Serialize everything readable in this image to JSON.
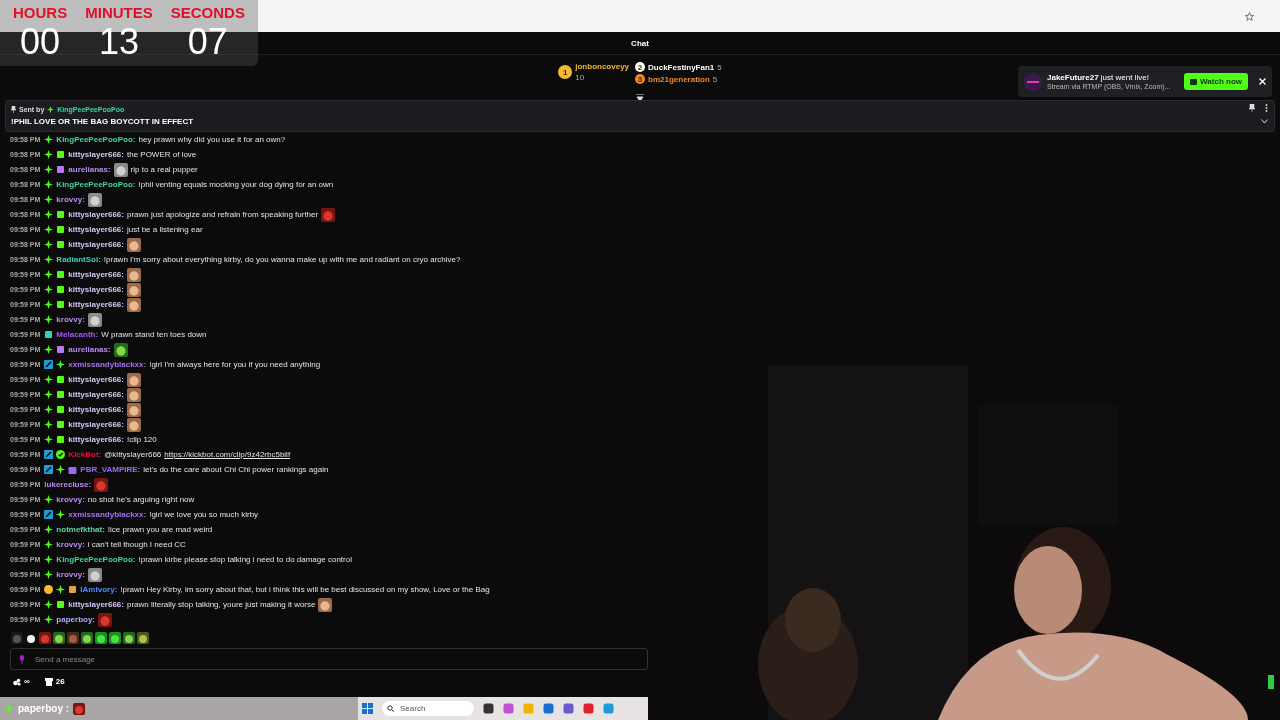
{
  "timer": {
    "units": [
      {
        "label": "HOURS",
        "value": "00"
      },
      {
        "label": "MINUTES",
        "value": "13"
      },
      {
        "label": "SECONDS",
        "value": "07"
      }
    ]
  },
  "chat": {
    "title": "Chat",
    "leaderboard": [
      {
        "rank": "1",
        "name": "jonboncoveyy",
        "count": "10",
        "color": "#f5b82e"
      },
      {
        "rank": "2",
        "name": "DuckFestinyFan1",
        "count": "5",
        "color": "#ffffff"
      },
      {
        "rank": "3",
        "name": "bm21generation",
        "count": "5",
        "color": "#f08a24"
      }
    ],
    "pinned": {
      "sent_by": "Sent by",
      "user": "KingPeePeePooPoo",
      "text": "!PHIL LOVE OR THE BAG BOYCOTT IN EFFECT"
    },
    "messages": [
      {
        "time": "09:58 PM",
        "badges": [
          {
            "kind": "star",
            "color": "#53fc18"
          }
        ],
        "user": "KingPeePeePooPoo:",
        "color": "#3fd7a0",
        "parts": [
          {
            "kind": "text",
            "text": "hey prawn why did you use it for an own?"
          }
        ]
      },
      {
        "time": "09:58 PM",
        "badges": [
          {
            "kind": "star",
            "color": "#53fc18"
          },
          {
            "kind": "box",
            "color": "#53fc18"
          }
        ],
        "user": "kittyslayer666:",
        "color": "#d9c6f5",
        "parts": [
          {
            "kind": "text",
            "text": "the POWER of love"
          }
        ]
      },
      {
        "time": "09:58 PM",
        "badges": [
          {
            "kind": "star",
            "color": "#53fc18"
          },
          {
            "kind": "box",
            "color": "#b47cf0"
          }
        ],
        "user": "aurelianas:",
        "color": "#b98cf5",
        "parts": [
          {
            "kind": "cat"
          },
          {
            "kind": "text",
            "text": "rip to a real pupper"
          }
        ]
      },
      {
        "time": "09:58 PM",
        "badges": [
          {
            "kind": "star",
            "color": "#53fc18"
          }
        ],
        "user": "KingPeePeePooPoo:",
        "color": "#3fd7a0",
        "parts": [
          {
            "kind": "text",
            "text": "!phil venting equals mocking your dog dying for an own"
          }
        ]
      },
      {
        "time": "09:58 PM",
        "badges": [
          {
            "kind": "star",
            "color": "#53fc18"
          }
        ],
        "user": "krovvy:",
        "color": "#b98cf5",
        "parts": [
          {
            "kind": "cat"
          }
        ]
      },
      {
        "time": "09:58 PM",
        "badges": [
          {
            "kind": "star",
            "color": "#53fc18"
          },
          {
            "kind": "box",
            "color": "#53fc18"
          }
        ],
        "user": "kittyslayer666:",
        "color": "#d9c6f5",
        "parts": [
          {
            "kind": "text",
            "text": "prawn just apologize and refrain from speaking further"
          },
          {
            "kind": "red"
          }
        ]
      },
      {
        "time": "09:58 PM",
        "badges": [
          {
            "kind": "star",
            "color": "#53fc18"
          },
          {
            "kind": "box",
            "color": "#53fc18"
          }
        ],
        "user": "kittyslayer666:",
        "color": "#d9c6f5",
        "parts": [
          {
            "kind": "text",
            "text": "just be a listening ear"
          }
        ]
      },
      {
        "time": "09:58 PM",
        "badges": [
          {
            "kind": "star",
            "color": "#53fc18"
          },
          {
            "kind": "box",
            "color": "#53fc18"
          }
        ],
        "user": "kittyslayer666:",
        "color": "#d9c6f5",
        "parts": [
          {
            "kind": "tan"
          }
        ]
      },
      {
        "time": "09:58 PM",
        "badges": [
          {
            "kind": "star",
            "color": "#53fc18"
          }
        ],
        "user": "RadiantSol:",
        "color": "#3ad0b5",
        "parts": [
          {
            "kind": "text",
            "text": "!prawn I'm sorry about everything kirby, do you wanna make up with me and radiant on cryo archive?"
          }
        ]
      },
      {
        "time": "09:59 PM",
        "badges": [
          {
            "kind": "star",
            "color": "#53fc18"
          },
          {
            "kind": "box",
            "color": "#53fc18"
          }
        ],
        "user": "kittyslayer666:",
        "color": "#d9c6f5",
        "parts": [
          {
            "kind": "tan"
          }
        ]
      },
      {
        "time": "09:59 PM",
        "badges": [
          {
            "kind": "star",
            "color": "#53fc18"
          },
          {
            "kind": "box",
            "color": "#53fc18"
          }
        ],
        "user": "kittyslayer666:",
        "color": "#d9c6f5",
        "parts": [
          {
            "kind": "tan"
          }
        ]
      },
      {
        "time": "09:59 PM",
        "badges": [
          {
            "kind": "star",
            "color": "#53fc18"
          },
          {
            "kind": "box",
            "color": "#53fc18"
          }
        ],
        "user": "kittyslayer666:",
        "color": "#d9c6f5",
        "parts": [
          {
            "kind": "tan"
          }
        ]
      },
      {
        "time": "09:59 PM",
        "badges": [
          {
            "kind": "star",
            "color": "#53fc18"
          }
        ],
        "user": "krovvy:",
        "color": "#b98cf5",
        "parts": [
          {
            "kind": "cat"
          }
        ]
      },
      {
        "time": "09:59 PM",
        "badges": [
          {
            "kind": "box",
            "color": "#2ed3b7"
          }
        ],
        "user": "Melacanth:",
        "color": "#a855f7",
        "parts": [
          {
            "kind": "text",
            "text": "W prawn stand ten toes down"
          }
        ]
      },
      {
        "time": "09:59 PM",
        "badges": [
          {
            "kind": "star",
            "color": "#53fc18"
          },
          {
            "kind": "box",
            "color": "#b47cf0"
          }
        ],
        "user": "aurelianas:",
        "color": "#b98cf5",
        "parts": [
          {
            "kind": "frog"
          }
        ]
      },
      {
        "time": "09:59 PM",
        "badges": [
          {
            "kind": "sword",
            "color": "#1f9bd8"
          },
          {
            "kind": "star",
            "color": "#53fc18"
          }
        ],
        "user": "xxmissandyblackxx:",
        "color": "#a970f2",
        "parts": [
          {
            "kind": "text",
            "text": "!girl I'm always here for you if you need anything"
          }
        ]
      },
      {
        "time": "09:59 PM",
        "badges": [
          {
            "kind": "star",
            "color": "#53fc18"
          },
          {
            "kind": "box",
            "color": "#53fc18"
          }
        ],
        "user": "kittyslayer666:",
        "color": "#d9c6f5",
        "parts": [
          {
            "kind": "tan"
          }
        ]
      },
      {
        "time": "09:59 PM",
        "badges": [
          {
            "kind": "star",
            "color": "#53fc18"
          },
          {
            "kind": "box",
            "color": "#53fc18"
          }
        ],
        "user": "kittyslayer666:",
        "color": "#d9c6f5",
        "parts": [
          {
            "kind": "tan"
          }
        ]
      },
      {
        "time": "09:59 PM",
        "badges": [
          {
            "kind": "star",
            "color": "#53fc18"
          },
          {
            "kind": "box",
            "color": "#53fc18"
          }
        ],
        "user": "kittyslayer666:",
        "color": "#d9c6f5",
        "parts": [
          {
            "kind": "tan"
          }
        ]
      },
      {
        "time": "09:59 PM",
        "badges": [
          {
            "kind": "star",
            "color": "#53fc18"
          },
          {
            "kind": "box",
            "color": "#53fc18"
          }
        ],
        "user": "kittyslayer666:",
        "color": "#d9c6f5",
        "parts": [
          {
            "kind": "tan"
          }
        ]
      },
      {
        "time": "09:59 PM",
        "badges": [
          {
            "kind": "star",
            "color": "#53fc18"
          },
          {
            "kind": "box",
            "color": "#53fc18"
          }
        ],
        "user": "kittyslayer666:",
        "color": "#d9c6f5",
        "parts": [
          {
            "kind": "text",
            "text": "!clip 120"
          }
        ]
      },
      {
        "time": "09:59 PM",
        "badges": [
          {
            "kind": "sword",
            "color": "#1f9bd8"
          },
          {
            "kind": "check",
            "color": "#53fc18"
          }
        ],
        "user": "KickBot:",
        "color": "#e0133f",
        "parts": [
          {
            "kind": "text",
            "text": "@kittyslayer666"
          },
          {
            "kind": "link",
            "text": "https://kickbot.com/clip/9z42rbc5bilf"
          }
        ]
      },
      {
        "time": "09:59 PM",
        "badges": [
          {
            "kind": "sword",
            "color": "#1f9bd8"
          },
          {
            "kind": "star",
            "color": "#53fc18"
          },
          {
            "kind": "gift",
            "color": "#9b6af2"
          }
        ],
        "user": "PBR_VAMPIRE:",
        "color": "#9b6af2",
        "parts": [
          {
            "kind": "text",
            "text": "let's do the care about Chi Chi power rankings again"
          }
        ]
      },
      {
        "time": "09:59 PM",
        "user": "lukerecluse:",
        "color": "#b98cf5",
        "parts": [
          {
            "kind": "red"
          }
        ]
      },
      {
        "time": "09:59 PM",
        "badges": [
          {
            "kind": "star",
            "color": "#53fc18"
          }
        ],
        "user": "krovvy:",
        "color": "#b98cf5",
        "parts": [
          {
            "kind": "text",
            "text": "no shot he's arguing right now"
          }
        ]
      },
      {
        "time": "09:59 PM",
        "badges": [
          {
            "kind": "sword",
            "color": "#1f9bd8"
          },
          {
            "kind": "star",
            "color": "#53fc18"
          }
        ],
        "user": "xxmissandyblackxx:",
        "color": "#a970f2",
        "parts": [
          {
            "kind": "text",
            "text": "!girl we love you so much kirby"
          }
        ]
      },
      {
        "time": "09:59 PM",
        "badges": [
          {
            "kind": "star",
            "color": "#53fc18"
          }
        ],
        "user": "notmefkthat:",
        "color": "#5ed9a0",
        "parts": [
          {
            "kind": "text",
            "text": "!ice prawn you are mad weird"
          }
        ]
      },
      {
        "time": "09:59 PM",
        "badges": [
          {
            "kind": "star",
            "color": "#53fc18"
          }
        ],
        "user": "krovvy:",
        "color": "#b98cf5",
        "parts": [
          {
            "kind": "text",
            "text": "i can't tell though I need CC"
          }
        ]
      },
      {
        "time": "09:59 PM",
        "badges": [
          {
            "kind": "star",
            "color": "#53fc18"
          }
        ],
        "user": "KingPeePeePooPoo:",
        "color": "#3fd7a0",
        "parts": [
          {
            "kind": "text",
            "text": "!prawn kirbe please stop talking i need to do damage control"
          }
        ]
      },
      {
        "time": "09:59 PM",
        "badges": [
          {
            "kind": "star",
            "color": "#53fc18"
          }
        ],
        "user": "krovvy:",
        "color": "#b98cf5",
        "parts": [
          {
            "kind": "cat"
          }
        ]
      },
      {
        "time": "09:59 PM",
        "badges": [
          {
            "kind": "coin",
            "color": "#f5b82e"
          },
          {
            "kind": "star",
            "color": "#53fc18"
          },
          {
            "kind": "box",
            "color": "#d9a441"
          }
        ],
        "user": "IAmIvory:",
        "color": "#4c8cf5",
        "parts": [
          {
            "kind": "text",
            "text": "!prawn Hey Kirby, im sorry about that, but i think this will be best discussed on my show, Love or the Bag"
          }
        ]
      },
      {
        "time": "09:59 PM",
        "badges": [
          {
            "kind": "star",
            "color": "#53fc18"
          },
          {
            "kind": "box",
            "color": "#53fc18"
          }
        ],
        "user": "kittyslayer666:",
        "color": "#d9c6f5",
        "parts": [
          {
            "kind": "text",
            "text": "prawn literally stop talking, youre just making it worse"
          },
          {
            "kind": "tan"
          }
        ]
      },
      {
        "time": "09:59 PM",
        "badges": [
          {
            "kind": "star",
            "color": "#53fc18"
          }
        ],
        "user": "paperboy:",
        "color": "#aab0f5",
        "parts": [
          {
            "kind": "red"
          }
        ]
      }
    ],
    "quick_emotes": [
      {
        "kind": "dark"
      },
      {
        "kind": "skull"
      },
      {
        "kind": "red"
      },
      {
        "kind": "frog"
      },
      {
        "kind": "brown"
      },
      {
        "kind": "frog"
      },
      {
        "kind": "green"
      },
      {
        "kind": "green"
      },
      {
        "kind": "frog"
      },
      {
        "kind": "olive"
      }
    ],
    "input": {
      "placeholder": "Send a message"
    },
    "footer": {
      "points": "∞",
      "store_count": "26"
    }
  },
  "notification": {
    "user": "JakeFuture27",
    "text": "just went live!",
    "subtext": "Stream via RTMP (OBS, Vmix, Zoom)...",
    "button": "Watch now"
  },
  "overlay": {
    "user": "paperboy :"
  },
  "taskbar": {
    "search_placeholder": "Search"
  }
}
